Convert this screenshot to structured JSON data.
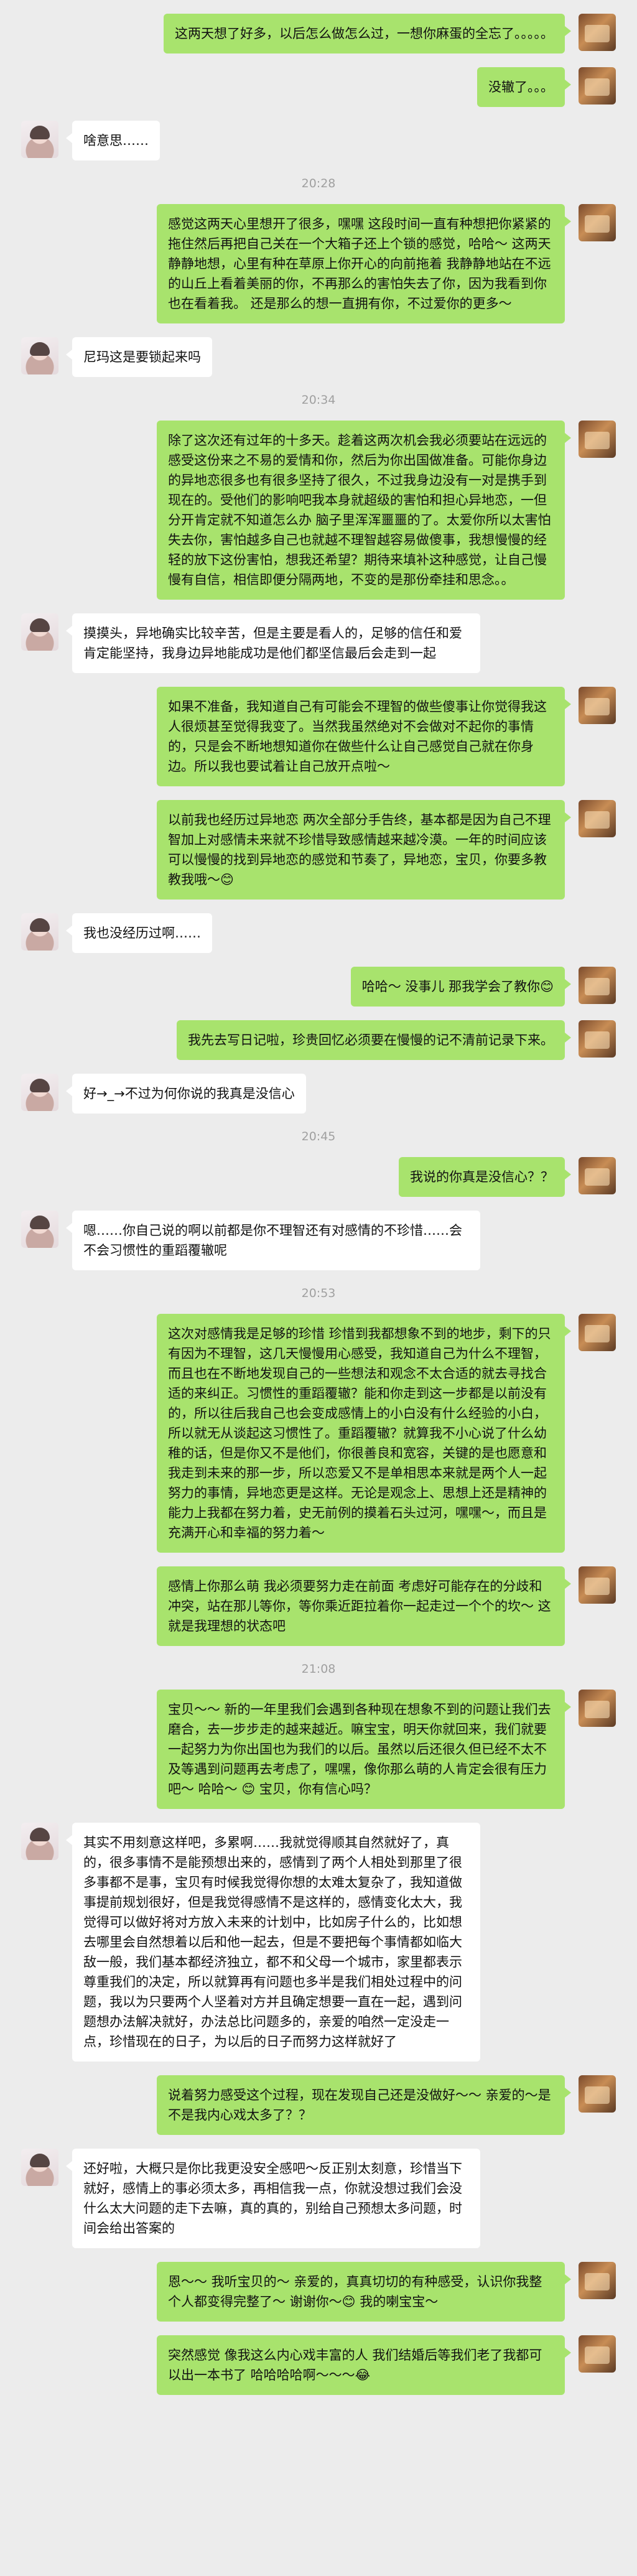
{
  "colors": {
    "background": "#ececec",
    "bubble_out": "#a8e36d",
    "bubble_in": "#ffffff",
    "timestamp": "#a0a0a0"
  },
  "chat": {
    "messages": [
      {
        "side": "out",
        "text": "这两天想了好多，以后怎么做怎么过，一想你麻蛋的全忘了。。。。。"
      },
      {
        "side": "out",
        "text": "没辙了。。。"
      },
      {
        "side": "in",
        "text": "啥意思……"
      },
      {
        "side": "time",
        "text": "20:28"
      },
      {
        "side": "out",
        "text": "感觉这两天心里想开了很多，嘿嘿 这段时间一直有种想把你紧紧的拖住然后再把自己关在一个大箱子还上个锁的感觉，哈哈～ 这两天静静地想，心里有种在草原上你开心的向前拖着 我静静地站在不远的山丘上看着美丽的你，不再那么的害怕失去了你，因为我看到你也在看着我。 还是那么的想一直拥有你，不过爱你的更多～"
      },
      {
        "side": "in",
        "text": "尼玛这是要锁起来吗"
      },
      {
        "side": "time",
        "text": "20:34"
      },
      {
        "side": "out",
        "text": "除了这次还有过年的十多天。趁着这两次机会我必须要站在远远的感受这份来之不易的爱情和你，然后为你出国做准备。可能你身边的异地恋很多也有很多坚持了很久，不过我身边没有一对是携手到现在的。受他们的影响吧我本身就超级的害怕和担心异地恋，一但分开肯定就不知道怎么办 脑子里浑浑噩噩的了。太爱你所以太害怕失去你，害怕越多自己也就越不理智越容易做傻事，我想慢慢的经轻的放下这份害怕，想我还希望？期待来填补这种感觉，让自己慢慢有自信，相信即便分隔两地，不变的是那份牵挂和思念。。"
      },
      {
        "side": "in",
        "text": "摸摸头，异地确实比较辛苦，但是主要是看人的，足够的信任和爱肯定能坚持，我身边异地能成功是他们都坚信最后会走到一起"
      },
      {
        "side": "out",
        "text": "如果不准备，我知道自己有可能会不理智的做些傻事让你觉得我这人很烦甚至觉得我变了。当然我虽然绝对不会做对不起你的事情的，只是会不断地想知道你在做些什么让自己感觉自己就在你身边。所以我也要试着让自己放开点啦～"
      },
      {
        "side": "out",
        "text": "以前我也经历过异地恋 两次全部分手告终，基本都是因为自己不理智加上对感情未来就不珍惜导致感情越来越冷漠。一年的时间应该可以慢慢的找到异地恋的感觉和节奏了，异地恋，宝贝，你要多教教我哦～😊"
      },
      {
        "side": "in",
        "text": "我也没经历过啊……"
      },
      {
        "side": "out",
        "text": "哈哈～ 没事儿 那我学会了教你😊"
      },
      {
        "side": "out",
        "text": "我先去写日记啦，珍贵回忆必须要在慢慢的记不清前记录下来。"
      },
      {
        "side": "in",
        "text": "好→_→不过为何你说的我真是没信心"
      },
      {
        "side": "time",
        "text": "20:45"
      },
      {
        "side": "out",
        "text": "我说的你真是没信心？？"
      },
      {
        "side": "in",
        "text": "嗯……你自己说的啊以前都是你不理智还有对感情的不珍惜……会不会习惯性的重蹈覆辙呢"
      },
      {
        "side": "time",
        "text": "20:53"
      },
      {
        "side": "out",
        "text": "这次对感情我是足够的珍惜 珍惜到我都想象不到的地步，剩下的只有因为不理智，这几天慢慢用心感受，我知道自己为什么不理智，而且也在不断地发现自己的一些想法和观念不太合适的就去寻找合适的来纠正。习惯性的重蹈覆辙？能和你走到这一步都是以前没有的，所以往后我自己也会变成感情上的小白没有什么经验的小白，所以就无从谈起这习惯性了。重蹈覆辙？就算我不小心说了什么幼稚的话，但是你又不是他们，你很善良和宽容，关键的是也愿意和我走到未来的那一步，所以恋爱又不是单相思本来就是两个人一起努力的事情，异地恋更是这样。无论是观念上、思想上还是精神的能力上我都在努力着，史无前例的摸着石头过河，嘿嘿～，而且是充满开心和幸福的努力着～"
      },
      {
        "side": "out",
        "text": "感情上你那么萌 我必须要努力走在前面 考虑好可能存在的分歧和冲突，站在那儿等你，等你乘近距拉着你一起走过一个个的坎～ 这就是我理想的状态吧"
      },
      {
        "side": "time",
        "text": "21:08"
      },
      {
        "side": "out",
        "text": "宝贝～～ 新的一年里我们会遇到各种现在想象不到的问题让我们去磨合，去一步步走的越来越近。嘛宝宝，明天你就回来，我们就要一起努力为你出国也为我们的以后。虽然以后还很久但已经不太不及等遇到问题再去考虑了，嘿嘿，像你那么萌的人肯定会很有压力吧～ 哈哈～ 😊 宝贝，你有信心吗？"
      },
      {
        "side": "in",
        "text": "其实不用刻意这样吧，多累啊……我就觉得顺其自然就好了，真的，很多事情不是能预想出来的，感情到了两个人相处到那里了很多事都不是事，宝贝有时候我觉得你想的太难太复杂了，我知道做事提前规划很好，但是我觉得感情不是这样的，感情变化太大，我觉得可以做好将对方放入未来的计划中，比如房子什么的，比如想去哪里会自然想着以后和他一起去，但是不要把每个事情都如临大敌一般，我们基本都经济独立，都不和父母一个城市，家里都表示尊重我们的决定，所以就算再有问题也多半是我们相处过程中的问题，我以为只要两个人坚着对方并且确定想要一直在一起，遇到问题想办法解决就好，办法总比问题多的，亲爱的咱然一定没走一点，珍惜现在的日子，为以后的日子而努力这样就好了"
      },
      {
        "side": "out",
        "text": "说着努力感受这个过程，现在发现自己还是没做好～～ 亲爱的～是不是我内心戏太多了？？"
      },
      {
        "side": "in",
        "text": "还好啦，大概只是你比我更没安全感吧～反正别太刻意，珍惜当下就好，感情上的事必须太多，再相信我一点，你就没想过我们会没什么太大问题的走下去嘛，真的真的，别给自己预想太多问题，时间会给出答案的"
      },
      {
        "side": "out",
        "text": "恩～～ 我听宝贝的～ 亲爱的，真真切切的有种感受，认识你我整个人都变得完整了～ 谢谢你～😊 我的喇宝宝～"
      },
      {
        "side": "out",
        "text": "突然感觉 像我这么内心戏丰富的人 我们结婚后等我们老了我都可以出一本书了 哈哈哈哈啊～～～😂"
      }
    ]
  }
}
